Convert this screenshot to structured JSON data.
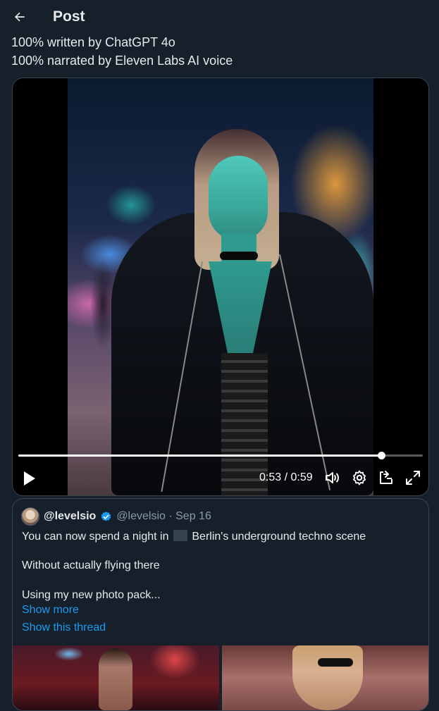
{
  "header": {
    "title": "Post"
  },
  "post": {
    "lines": [
      "100% written by ChatGPT 4o",
      "100% narrated by Eleven Labs AI voice"
    ]
  },
  "video": {
    "progress": 0.898,
    "time_display": "0:53 / 0:59",
    "controls": [
      "play-icon",
      "volume-icon",
      "settings-icon",
      "pip-icon",
      "fullscreen-icon"
    ]
  },
  "quote": {
    "display_name": "@levelsio",
    "handle_date": "@levelsio · Sep 16",
    "line1_before": "You can now spend a night in",
    "line1_after": "Berlin's underground techno scene",
    "line2": "Without actually flying there",
    "line3": "Using my new photo pack...",
    "show_more": "Show more",
    "show_thread": "Show this thread"
  },
  "colors": {
    "background": "#15202b",
    "border": "#38444d",
    "link": "#1d9bf0",
    "verified": "#1d9bf0",
    "muted": "#8b98a5"
  }
}
